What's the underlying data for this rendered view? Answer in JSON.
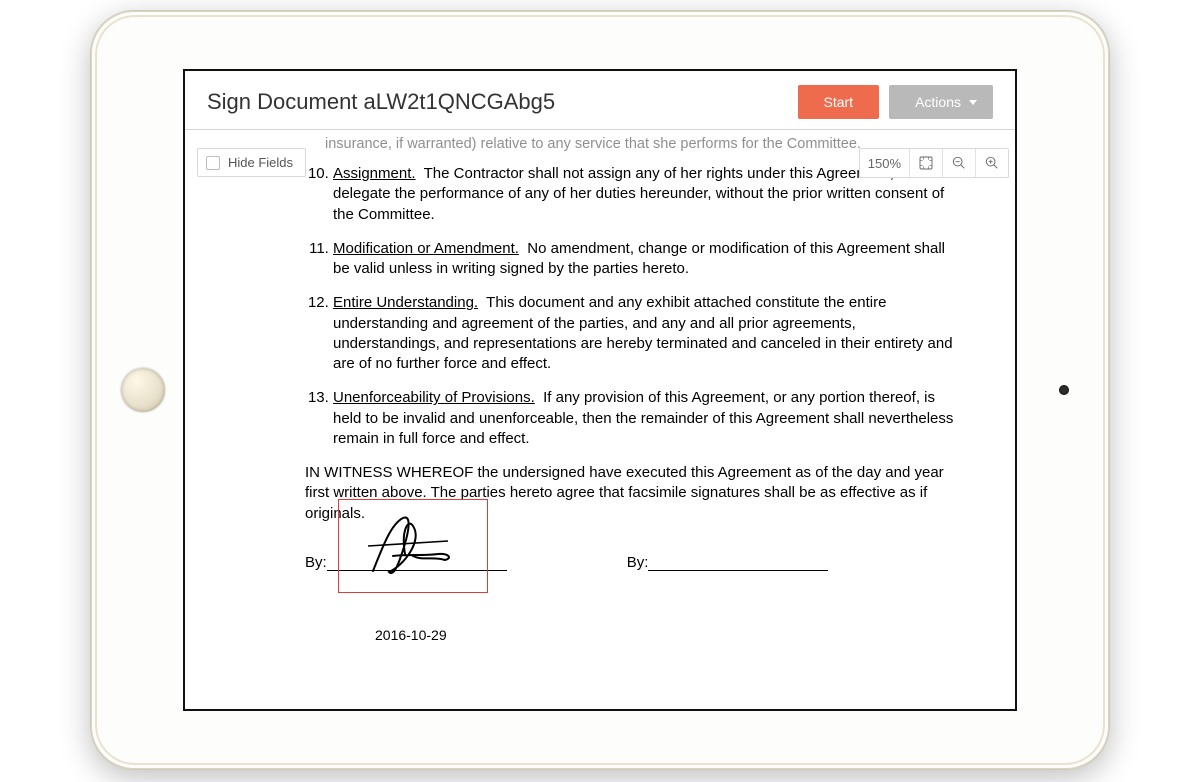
{
  "header": {
    "title": "Sign Document aLW2t1QNCGAbg5",
    "start_label": "Start",
    "actions_label": "Actions"
  },
  "toolbar": {
    "hide_fields_label": "Hide Fields",
    "zoom_level": "150%"
  },
  "document": {
    "partial_prev_line": "insurance, if warranted) relative to any service that she performs for the Committee.",
    "list_start": 10,
    "clauses": [
      {
        "head": "Assignment.",
        "body": "The Contractor shall not assign any of her rights under this Agreement, or delegate the performance of any of her duties hereunder, without the prior written consent of the Committee."
      },
      {
        "head": "Modification or Amendment.",
        "body": "No amendment, change or modification of this Agreement shall be valid unless in writing signed by the parties hereto."
      },
      {
        "head": "Entire Understanding.",
        "body": "This document and any exhibit attached constitute the entire understanding and agreement of the parties, and any and all prior agreements, understandings, and representations are hereby terminated and canceled in their entirety and are of no further force and effect."
      },
      {
        "head": "Unenforceability of Provisions.",
        "body": "If any provision of this Agreement, or any portion thereof, is held to be invalid and unenforceable, then the remainder of this Agreement shall nevertheless remain in full force and effect."
      }
    ],
    "witness_text": "IN WITNESS WHEREOF the undersigned have executed this Agreement as of the day and year first written above.  The parties hereto agree that facsimile signatures shall be as effective as if originals.",
    "by_label": "By:",
    "signature_date": "2016-10-29"
  }
}
